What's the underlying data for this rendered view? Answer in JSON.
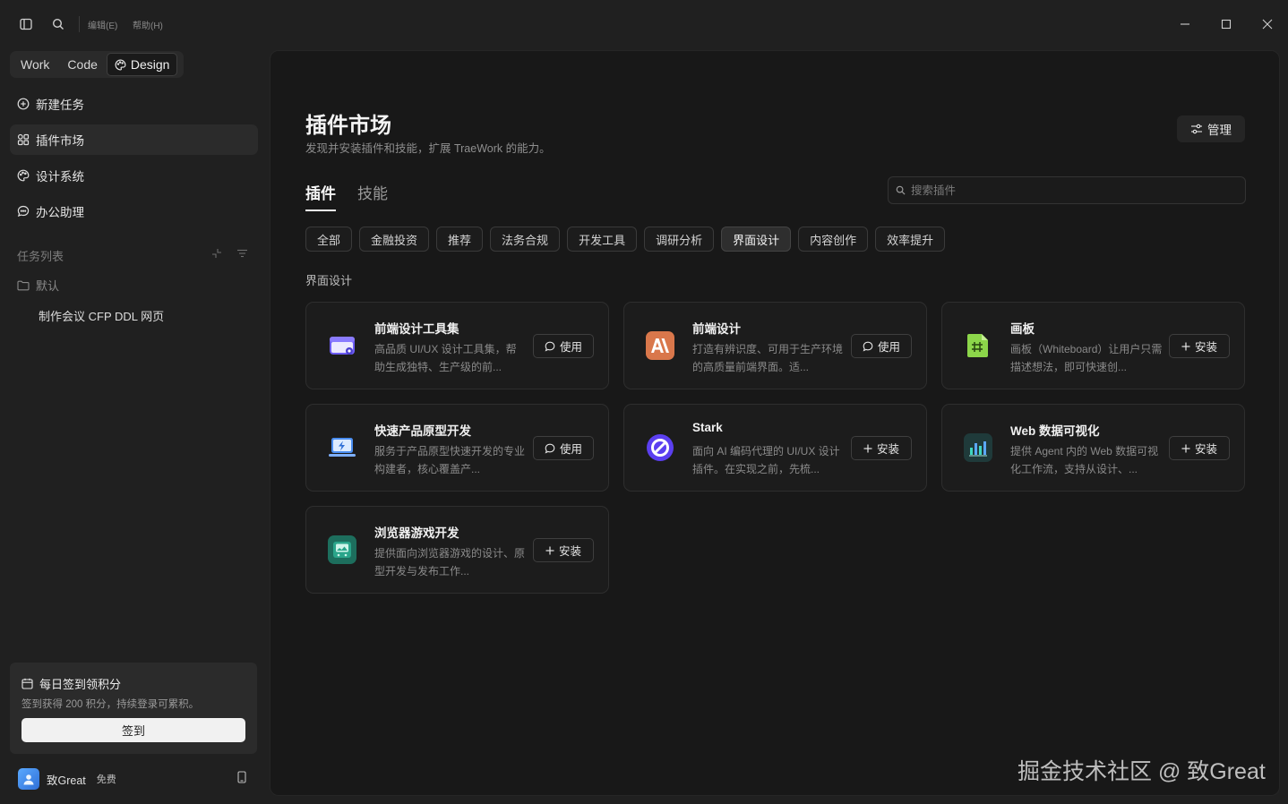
{
  "titlebar": {
    "menus": [
      "编辑(E)",
      "帮助(H)"
    ]
  },
  "modes": [
    {
      "label": "Work"
    },
    {
      "label": "Code"
    },
    {
      "label": "Design"
    }
  ],
  "nav": [
    {
      "label": "新建任务",
      "icon": "add-circle-icon"
    },
    {
      "label": "插件市场",
      "icon": "apps-grid-icon"
    },
    {
      "label": "设计系统",
      "icon": "palette-icon"
    },
    {
      "label": "办公助理",
      "icon": "chat-bubble-icon"
    }
  ],
  "tasks": {
    "section_label": "任务列表",
    "folder": "默认",
    "items": [
      "制作会议 CFP DDL 网页"
    ]
  },
  "checkin": {
    "title": "每日签到领积分",
    "desc": "签到获得 200 积分，持续登录可累积。",
    "button": "签到"
  },
  "user": {
    "name": "致Great",
    "plan": "免费"
  },
  "main": {
    "title": "插件市场",
    "subtitle": "发现并安装插件和技能，扩展 TraeWork 的能力。",
    "manage": "管理",
    "tabs": [
      "插件",
      "技能"
    ],
    "search_placeholder": "搜索插件",
    "categories": [
      "全部",
      "金融投资",
      "推荐",
      "法务合规",
      "开发工具",
      "调研分析",
      "界面设计",
      "内容创作",
      "效率提升"
    ],
    "active_category": "界面设计",
    "group_label": "界面设计",
    "plugins": [
      {
        "title": "前端设计工具集",
        "desc": "高品质 UI/UX 设计工具集，帮助生成独特、生产级的前...",
        "action": "使用",
        "icon": "window-icon",
        "color": "#6d5cf6"
      },
      {
        "title": "前端设计",
        "desc": "打造有辨识度、可用于生产环境的高质量前端界面。适...",
        "action": "使用",
        "icon": "anthropic-logo-icon",
        "color": "#d9774b"
      },
      {
        "title": "画板",
        "desc": "画板（Whiteboard）让用户只需描述想法，即可快速创...",
        "action": "安装",
        "icon": "whiteboard-icon",
        "color": "#8cd64a"
      },
      {
        "title": "快速产品原型开发",
        "desc": "服务于产品原型快速开发的专业构建者，核心覆盖产...",
        "action": "使用",
        "icon": "laptop-bolt-icon",
        "color": "#4a8df0"
      },
      {
        "title": "Stark",
        "desc": "面向 AI 编码代理的 UI/UX 设计插件。在实现之前，先梳...",
        "action": "安装",
        "icon": "stark-logo-icon",
        "color": "#5b3ff0"
      },
      {
        "title": "Web 数据可视化",
        "desc": "提供 Agent 内的 Web 数据可视化工作流，支持从设计、...",
        "action": "安装",
        "icon": "bar-chart-icon",
        "color": "#1f3a3a"
      },
      {
        "title": "浏览器游戏开发",
        "desc": "提供面向浏览器游戏的设计、原型开发与发布工作...",
        "action": "安装",
        "icon": "game-console-icon",
        "color": "#2aa58a"
      }
    ]
  },
  "watermark": "掘金技术社区 @ 致Great"
}
